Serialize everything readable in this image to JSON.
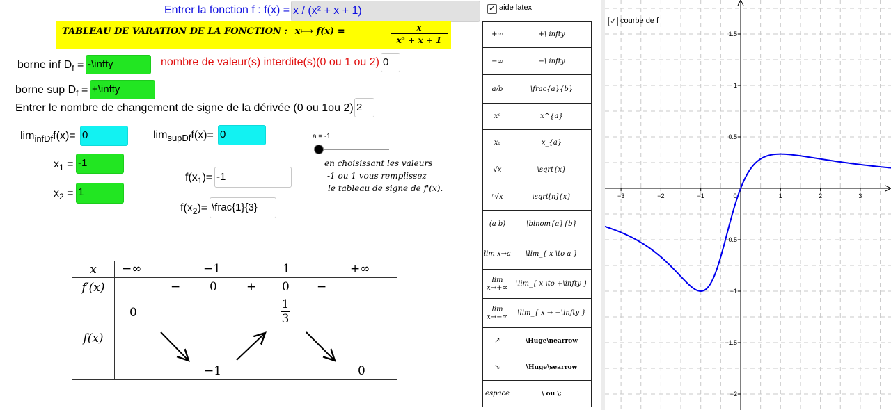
{
  "function_input": {
    "label": "Entrer la fonction f : f(x) =",
    "value": "x / (x² + x + 1)"
  },
  "banner": {
    "prefix": "TABLEAU DE VARATION DE LA FONCTION :",
    "map": "x⟼ f(x) =",
    "numerator": "x",
    "denominator": "x² + x + 1"
  },
  "domain": {
    "inf_label": "borne inf D",
    "sub": "f",
    "eq": " =",
    "inf_value": "-\\infty",
    "sup_label": "borne sup D",
    "sup_value": "+\\infty"
  },
  "forbidden": {
    "label": "nombre de valeur(s) interdite(s)(0 ou 1 ou 2)",
    "value": "0"
  },
  "sign_changes": {
    "label": "Entrer le nombre de changement de signe de la dérivée (0 ou 1ou 2)",
    "value": "2"
  },
  "limits": {
    "lim": "lim",
    "inf_sub": "infDf",
    "sup_sub": "supDf",
    "fx": "f(x)=",
    "inf_value": "0",
    "sup_value": "0"
  },
  "roots": {
    "x": "x",
    "x1_sub": "1",
    "x1_value": "-1",
    "x2_sub": "2",
    "x2_value": "1",
    "eq": " =",
    "fx1_label": "f(x",
    "fx1_sub": "1",
    "fx1_close": ")=",
    "fx1_value": "-1",
    "fx2_close": ")=",
    "fx2_value": "\\frac{1}{3}"
  },
  "slider": {
    "label": "a = -1",
    "value": -1,
    "min": -1,
    "max": 1
  },
  "instructions": [
    "en choisissant les valeurs",
    "-1 ou 1 vous remplissez",
    "le tableau de signe de f'(x)."
  ],
  "aide_latex": {
    "label": "aide latex",
    "checked": true
  },
  "latex_help": [
    {
      "symbol": "+∞",
      "code": "+\\ infty"
    },
    {
      "symbol": "−∞",
      "code": "−\\ infty"
    },
    {
      "symbol": "a/b",
      "code": "\\frac{a}{b}"
    },
    {
      "symbol": "xᵃ",
      "code": "x^{a}"
    },
    {
      "symbol": "xₐ",
      "code": "x_{a}"
    },
    {
      "symbol": "√x",
      "code": "\\sqrt{x}"
    },
    {
      "symbol": "ⁿ√x",
      "code": "\\sqrt[n]{x}"
    },
    {
      "symbol": "(a b)",
      "code": "\\binom{a}{b}"
    },
    {
      "symbol": "lim x→a",
      "code": "\\lim_{ x \\to a }"
    },
    {
      "symbol": "lim x→+∞",
      "code": "\\lim_{ x \\to +\\infty }"
    },
    {
      "symbol": "lim x→−∞",
      "code": "\\lim_{ x → −\\infty }"
    },
    {
      "symbol": "↗",
      "code": "\\Huge\\nearrow"
    },
    {
      "symbol": "↘",
      "code": "\\Huge\\searrow"
    },
    {
      "symbol": "espace",
      "code": "\\    ou    \\;"
    }
  ],
  "variation_table": {
    "x_label": "x",
    "fp_label": "f′(x)",
    "f_label": "f(x)",
    "x_values": [
      "−∞",
      "−1",
      "1",
      "+∞"
    ],
    "signs": [
      "−",
      "0",
      "+",
      "0",
      "−"
    ],
    "f_values": {
      "start": "0",
      "min": "−1",
      "max_num": "1",
      "max_den": "3",
      "end": "0"
    }
  },
  "graph": {
    "checkbox_label": "courbe de f",
    "checked": true,
    "x_ticks": [
      "−3",
      "−2",
      "−1",
      "0",
      "1",
      "2",
      "3"
    ],
    "y_ticks": [
      "1.5",
      "1",
      "0.5",
      "−0.5",
      "−1",
      "−1.5",
      "−2"
    ],
    "curve_color": "#0000ee"
  },
  "colors": {
    "blue": "#1010e0",
    "red": "#e01010",
    "banner": "#ffff00",
    "green": "#22e622",
    "cyan": "#12f2f2"
  }
}
